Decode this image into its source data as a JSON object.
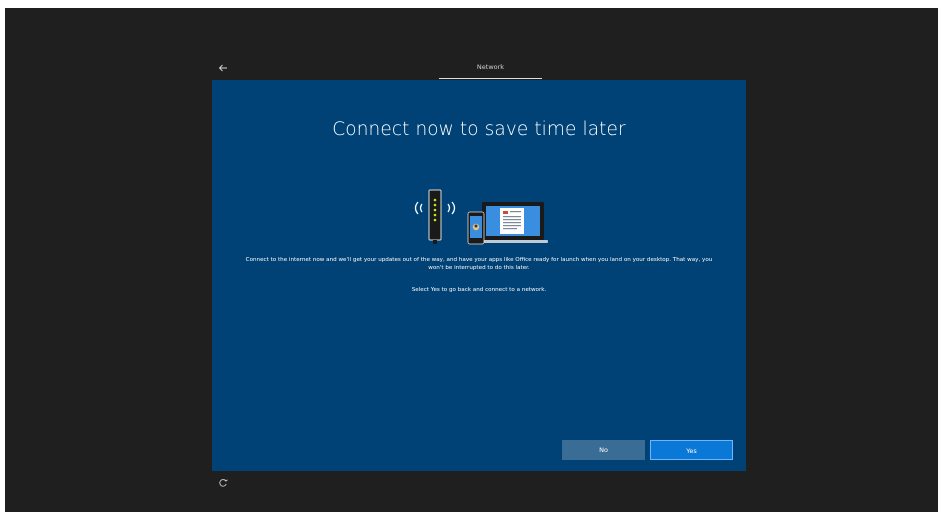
{
  "header": {
    "back_icon": "arrow-left-icon",
    "tab_label": "Network"
  },
  "main": {
    "headline": "Connect now to save time later",
    "illustration_icon": "router-and-devices-icon",
    "body_text": "Connect to the internet now and we'll get your updates out of the way, and have your apps like Office ready for launch when you land on your desktop. That way, you won't be interrupted to do this later.",
    "hint_text": "Select Yes to go back and connect to a network."
  },
  "buttons": {
    "no_label": "No",
    "yes_label": "Yes"
  },
  "footer": {
    "accessibility_icon": "ease-of-access-icon"
  },
  "colors": {
    "panel": "#004275",
    "background": "#1f1f1f",
    "primary_button": "#0a78d7",
    "secondary_button": "#3a6d96"
  }
}
